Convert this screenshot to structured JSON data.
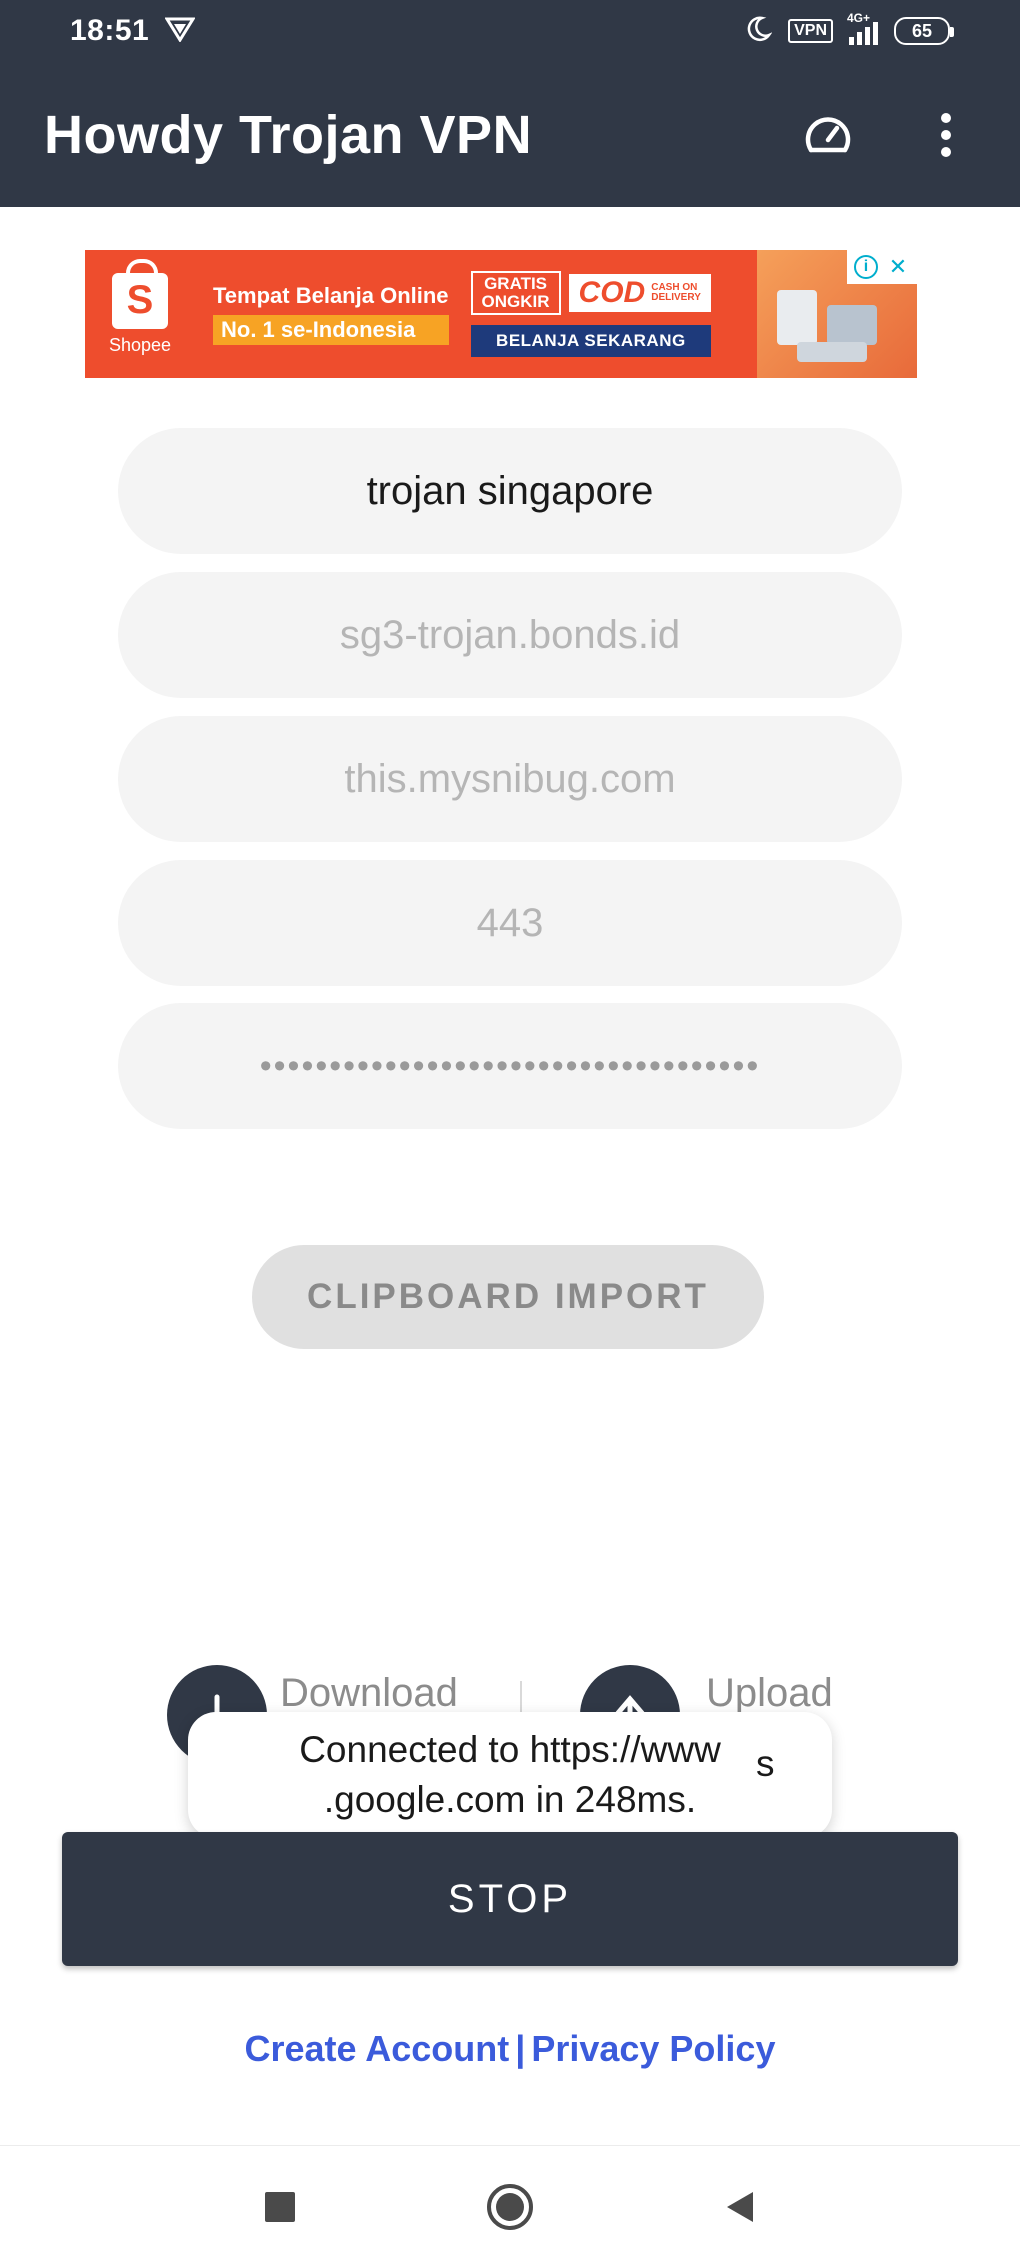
{
  "status_bar": {
    "time": "18:51",
    "network": "4G+",
    "vpn_label": "VPN",
    "battery": "65"
  },
  "app_bar": {
    "title": "Howdy Trojan VPN",
    "speed_icon": "speedometer-icon",
    "menu_icon": "more-vert-icon"
  },
  "ad": {
    "brand": "Shopee",
    "logo_letter": "S",
    "line1": "Tempat Belanja Online",
    "line2": "No. 1 se-Indonesia",
    "badge_gratis": "GRATIS ONGKIR",
    "badge_cod": "COD",
    "badge_cod_sub": "CASH ON DELIVERY",
    "cta": "BELANJA SEKARANG",
    "info_icon": "info-icon",
    "close_icon": "close-icon",
    "colors": {
      "bg": "#ee4d2d",
      "accent": "#f7a324",
      "cta": "#1e3a7b"
    }
  },
  "form": {
    "remark": "trojan singapore",
    "server_placeholder": "sg3-trojan.bonds.id",
    "sni_placeholder": "this.mysnibug.com",
    "port_placeholder": "443",
    "password_masked": "••••••••••••••••••••••••••••••••••••"
  },
  "clipboard_button": "CLIPBOARD IMPORT",
  "traffic": {
    "download_label": "Download",
    "upload_label": "Upload"
  },
  "toast": {
    "line1": "Connected to https://www",
    "line2": ".google.com in 248ms.",
    "tail": "s"
  },
  "stop_button": "STOP",
  "links": {
    "create_account": "Create Account",
    "separator": "|",
    "privacy_policy": "Privacy Policy"
  },
  "nav": {
    "recents_icon": "square-icon",
    "home_icon": "circle-home-icon",
    "back_icon": "triangle-back-icon"
  },
  "colors": {
    "primary": "#303846",
    "link": "#3b5bdb",
    "field_bg": "#f4f4f4"
  }
}
